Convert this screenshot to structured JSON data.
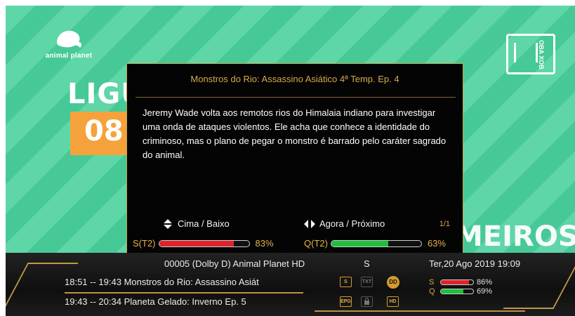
{
  "background": {
    "channel_logo_text": "animal planet",
    "headline_word": "LIGU",
    "badge_number": "08",
    "lower_word": "MEIROS",
    "corner_logo_text": "OBA XOB",
    "stripe_colors": [
      "#5fd6a8",
      "#46c996"
    ],
    "accent": "#f6a23c"
  },
  "epg_popup": {
    "title": "Monstros do Rio: Assassino Asiático 4ª Temp. Ep. 4",
    "description": "Jeremy Wade volta aos remotos rios do Himalaia indiano para investigar uma onda de ataques violentos. Ele acha que conhece a identidade do criminoso, mas o plano de pegar o monstro é barrado pelo caráter sagrado do animal.",
    "nav_updown_label": "Cima / Baixo",
    "nav_nownext_label": "Agora / Próximo",
    "page_indicator": "1/1",
    "signal_strength": {
      "label": "S(T2)",
      "value": 83,
      "text": "83%",
      "color": "#e0222b"
    },
    "signal_quality": {
      "label": "Q(T2)",
      "value": 63,
      "text": "63%",
      "color": "#1fbf3a"
    }
  },
  "infobar": {
    "channel_line": "00005  (Dolby D) Animal Planet HD",
    "service_type": "S",
    "datetime": "Ter,20 Ago 2019 19:09",
    "programs": [
      {
        "time": "18:51 -- 19:43",
        "title": "Monstros do Rio: Assassino Asiát"
      },
      {
        "time": "19:43 -- 20:34",
        "title": "Planeta Gelado: Inverno Ep. 5"
      }
    ],
    "icons": [
      "S",
      "TXT",
      "EPG",
      "LOCK",
      "HD",
      "DOLBY"
    ],
    "strength": {
      "label": "S",
      "value": 86,
      "text": "86%",
      "color": "#e0222b"
    },
    "quality": {
      "label": "Q",
      "value": 69,
      "text": "69%",
      "color": "#1fbf3a"
    }
  }
}
